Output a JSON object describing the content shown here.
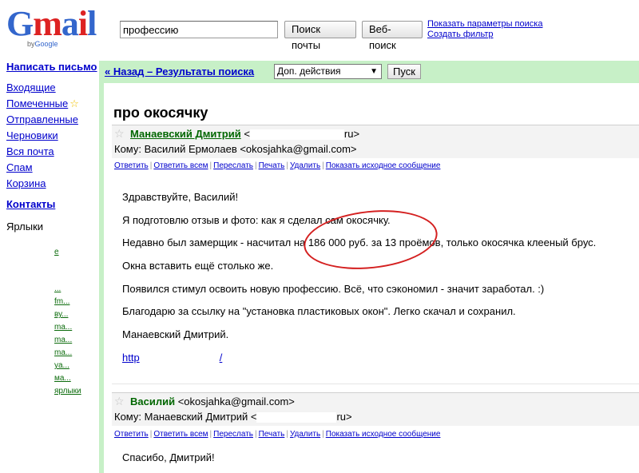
{
  "logo": {
    "main": "Gmail",
    "sub_by": "by",
    "sub_brand": "Google"
  },
  "search": {
    "value": "профессию",
    "search_mail": "Поиск почты",
    "web_search": "Веб-поиск",
    "show_options": "Показать параметры поиска",
    "create_filter": "Создать фильтр"
  },
  "sidebar": {
    "compose": "Написать письмо",
    "items": [
      {
        "label": "Входящие"
      },
      {
        "label": "Помеченные"
      },
      {
        "label": "Отправленные"
      },
      {
        "label": "Черновики"
      },
      {
        "label": "Вся почта"
      },
      {
        "label": "Спам"
      },
      {
        "label": "Корзина"
      }
    ],
    "contacts": "Контакты",
    "labels_title": "Ярлыки",
    "label_fragments": [
      "е",
      "...",
      "fm...",
      "ву...",
      "ma...",
      "ma...",
      "ma...",
      "ya...",
      "ма...",
      "ярлыки"
    ]
  },
  "toolbar": {
    "back": "« Назад – Результаты поиска",
    "more_actions": "Доп. действия",
    "go": "Пуск"
  },
  "thread": {
    "subject": "про окосячку"
  },
  "message1": {
    "sender_name": "Манаевский Дмитрий",
    "sender_email_prefix": "<",
    "sender_email_suffix": "ru>",
    "to_line": "Кому: Василий Ермолаев <okosjahka@gmail.com>",
    "actions": [
      "Ответить",
      "Ответить всем",
      "Переслать",
      "Печать",
      "Удалить",
      "Показать исходное сообщение"
    ],
    "body": [
      "Здравствуйте, Василий!",
      "Я подготовлю отзыв и фото: как я сделал сам окосячку.",
      "Недавно был замерщик - насчитал на 186 000 руб. за 13 проёмов, только окосячка клееный брус.",
      "Окна вставить ещё столько же.",
      "Появился стимул освоить новую профессию. Всё, что сэкономил - значит заработал. :)",
      " Благодарю за ссылку на \"установка пластиковых окон\". Легко скачал и сохранил.",
      "Манаевский Дмитрий."
    ],
    "link_start": "http",
    "link_end": "/"
  },
  "message2": {
    "sender_name": "Василий",
    "sender_email": "<okosjahka@gmail.com>",
    "to_prefix": "Кому: Манаевский Дмитрий <",
    "to_suffix": "ru>",
    "actions": [
      "Ответить",
      "Ответить всем",
      "Переслать",
      "Печать",
      "Удалить",
      "Показать исходное сообщение"
    ],
    "body": [
      "Спасибо, Дмитрий!"
    ]
  },
  "colors": {
    "frame": "#c7f0c7",
    "link": "#0000cc",
    "annotation": "#d42020"
  }
}
